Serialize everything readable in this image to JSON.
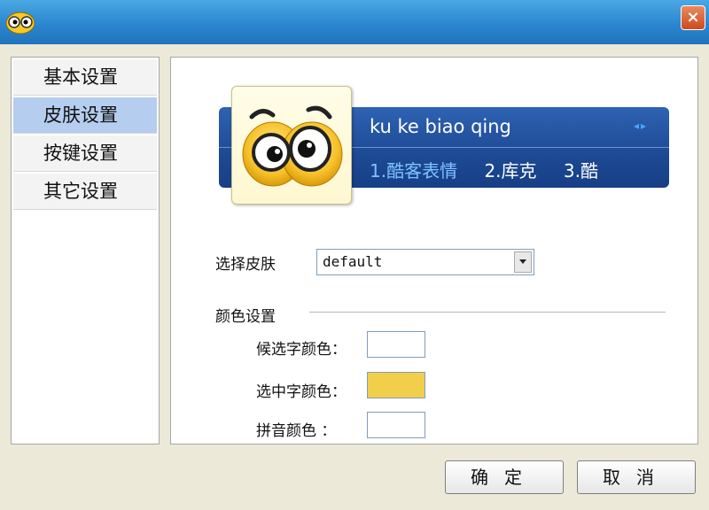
{
  "window": {
    "close_label": "×"
  },
  "sidebar": {
    "items": [
      {
        "label": "基本设置",
        "active": false
      },
      {
        "label": "皮肤设置",
        "active": true
      },
      {
        "label": "按键设置",
        "active": false
      },
      {
        "label": "其它设置",
        "active": false
      }
    ]
  },
  "skin_banner": {
    "name": "ku ke biao qing",
    "nav_arrows": "◂▸",
    "options": [
      "1.酷客表情",
      "2.库克",
      "3.酷"
    ]
  },
  "skin_select": {
    "label": "选择皮肤",
    "value": "default"
  },
  "color_settings": {
    "heading": "颜色设置",
    "items": [
      {
        "label": "候选字颜色：",
        "color": "#ffffff"
      },
      {
        "label": "选中字颜色：",
        "color": "#f2cf4a"
      },
      {
        "label": "拼音颜色  ：",
        "color": "#ffffff"
      }
    ]
  },
  "buttons": {
    "ok": "确定",
    "cancel": "取消"
  }
}
